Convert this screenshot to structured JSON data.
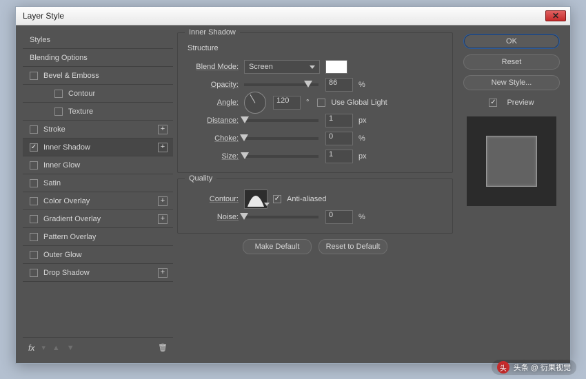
{
  "window": {
    "title": "Layer Style"
  },
  "sidebar": {
    "header": "Styles",
    "rows": [
      {
        "label": "Blending Options",
        "checkbox": false,
        "indent": 0,
        "selected": false,
        "plus": false
      },
      {
        "label": "Bevel & Emboss",
        "checkbox": true,
        "checked": false,
        "indent": 0,
        "selected": false,
        "plus": false
      },
      {
        "label": "Contour",
        "checkbox": true,
        "checked": false,
        "indent": 2,
        "selected": false,
        "plus": false
      },
      {
        "label": "Texture",
        "checkbox": true,
        "checked": false,
        "indent": 2,
        "selected": false,
        "plus": false
      },
      {
        "label": "Stroke",
        "checkbox": true,
        "checked": false,
        "indent": 0,
        "selected": false,
        "plus": true
      },
      {
        "label": "Inner Shadow",
        "checkbox": true,
        "checked": true,
        "indent": 0,
        "selected": true,
        "plus": true
      },
      {
        "label": "Inner Glow",
        "checkbox": true,
        "checked": false,
        "indent": 0,
        "selected": false,
        "plus": false
      },
      {
        "label": "Satin",
        "checkbox": true,
        "checked": false,
        "indent": 0,
        "selected": false,
        "plus": false
      },
      {
        "label": "Color Overlay",
        "checkbox": true,
        "checked": false,
        "indent": 0,
        "selected": false,
        "plus": true
      },
      {
        "label": "Gradient Overlay",
        "checkbox": true,
        "checked": false,
        "indent": 0,
        "selected": false,
        "plus": true
      },
      {
        "label": "Pattern Overlay",
        "checkbox": true,
        "checked": false,
        "indent": 0,
        "selected": false,
        "plus": false
      },
      {
        "label": "Outer Glow",
        "checkbox": true,
        "checked": false,
        "indent": 0,
        "selected": false,
        "plus": false
      },
      {
        "label": "Drop Shadow",
        "checkbox": true,
        "checked": false,
        "indent": 0,
        "selected": false,
        "plus": true
      }
    ]
  },
  "footer": {
    "fx": "fx"
  },
  "panel": {
    "title": "Inner Shadow",
    "structure_title": "Structure",
    "blend_mode_label": "Blend Mode:",
    "blend_mode_value": "Screen",
    "color": "#FFFFFF",
    "opacity_label": "Opacity:",
    "opacity_value": "86",
    "opacity_unit": "%",
    "angle_label": "Angle:",
    "angle_value": "120",
    "angle_unit": "°",
    "use_global_label": "Use Global Light",
    "use_global_checked": false,
    "distance_label": "Distance:",
    "distance_value": "1",
    "distance_unit": "px",
    "choke_label": "Choke:",
    "choke_value": "0",
    "choke_unit": "%",
    "size_label": "Size:",
    "size_value": "1",
    "size_unit": "px",
    "quality_title": "Quality",
    "contour_label": "Contour:",
    "antialiased_label": "Anti-aliased",
    "antialiased_checked": true,
    "noise_label": "Noise:",
    "noise_value": "0",
    "noise_unit": "%",
    "make_default": "Make Default",
    "reset_default": "Reset to Default"
  },
  "right": {
    "ok": "OK",
    "reset": "Reset",
    "new_style": "New Style...",
    "preview_label": "Preview",
    "preview_checked": true
  },
  "watermark": "头条 @ 衍果视觉"
}
